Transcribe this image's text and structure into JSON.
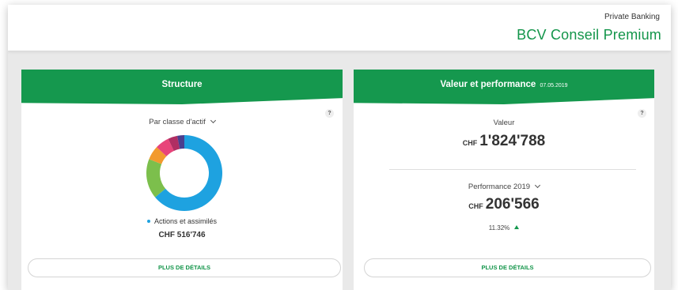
{
  "brand": {
    "sub": "Private Banking",
    "main": "BCV Conseil Premium"
  },
  "structure": {
    "title": "Structure",
    "help": "?",
    "selector": "Par classe d'actif",
    "legend_label": "Actions et assimilés",
    "legend_value": "CHF 516'746",
    "details_button": "PLUS DE DÉTAILS"
  },
  "performance": {
    "title": "Valeur et performance",
    "date": "07.05.2019",
    "help": "?",
    "valeur_label": "Valeur",
    "valeur_currency": "CHF",
    "valeur_amount": "1'824'788",
    "perf_selector": "Performance 2019",
    "perf_currency": "CHF",
    "perf_amount": "206'566",
    "perf_pct": "11.32%",
    "details_button": "PLUS DE DÉTAILS"
  },
  "chart_data": {
    "type": "pie",
    "donut": true,
    "slices": [
      {
        "color": "#1ea2e0",
        "share": 0.64
      },
      {
        "color": "#7cbf4c",
        "share": 0.17
      },
      {
        "color": "#f29a2e",
        "share": 0.06
      },
      {
        "color": "#e8447a",
        "share": 0.06
      },
      {
        "color": "#b02e63",
        "share": 0.04
      },
      {
        "color": "#4a3f8f",
        "share": 0.03
      }
    ]
  }
}
